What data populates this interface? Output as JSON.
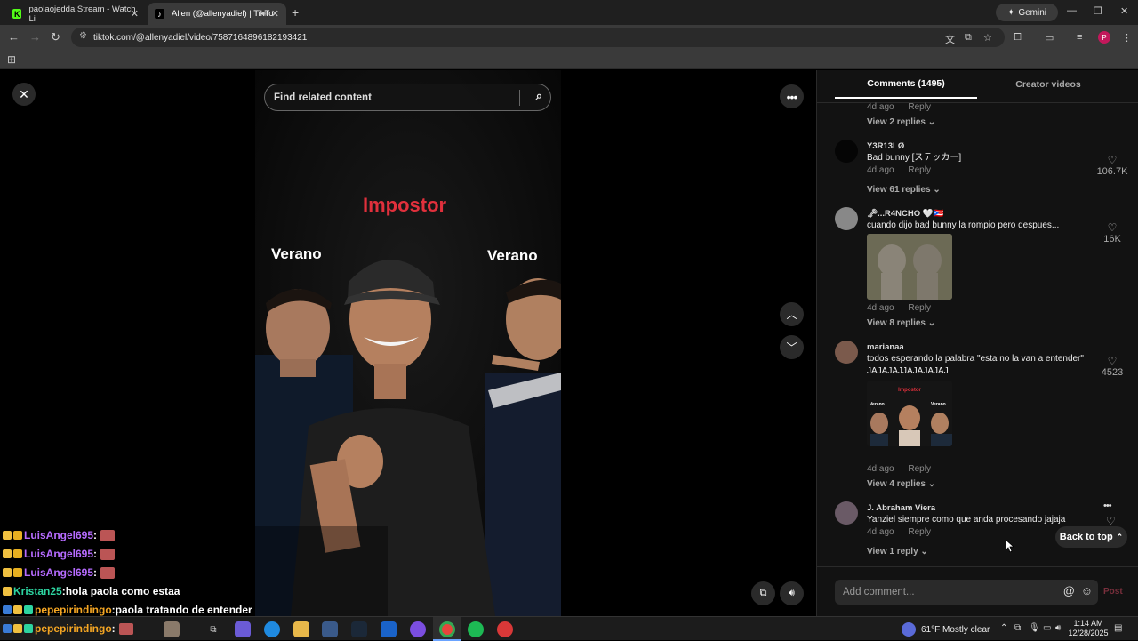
{
  "browser": {
    "tabs": [
      {
        "title": "paolaojedda Stream - Watch Li",
        "favicon": "kick-icon",
        "color": "#53fc18"
      },
      {
        "title": "Allen (@allenyadiel) | TikTo",
        "favicon": "tiktok-icon",
        "color": "#ffffff"
      }
    ],
    "new_tab_label": "+",
    "gemini_label": "Gemini",
    "url": "tiktok.com/@allenyadiel/video/7587164896182193421",
    "profile_initial": "P"
  },
  "video": {
    "search_placeholder": "Find related content",
    "overlay_title": "Impostor",
    "overlay_left": "Verano",
    "overlay_right": "Verano"
  },
  "comments_panel": {
    "tab_comments": "Comments (1495)",
    "tab_creator": "Creator videos",
    "top_meta": {
      "age": "4d ago",
      "reply": "Reply"
    },
    "top_view_replies": "View 2 replies",
    "comments": [
      {
        "user": "Y3R13LØ",
        "text": "Bad bunny [ステッカー]",
        "age": "4d ago",
        "reply": "Reply",
        "likes": "106.7K",
        "view_replies": "View 61 replies"
      },
      {
        "user": "🗝...R4NCHO 🤍🇵🇷",
        "text": "cuando dijo bad bunny la rompio pero despues...",
        "age": "4d ago",
        "reply": "Reply",
        "likes": "16K",
        "view_replies": "View 8 replies"
      },
      {
        "user": "marianaa",
        "text": "todos esperando la palabra \"esta no la van a entender\" JAJAJAJJAJAJAJAJ",
        "age": "4d ago",
        "reply": "Reply",
        "likes": "4523",
        "view_replies": "View 4 replies",
        "thumb_title": "Impostor",
        "thumb_left": "Verano",
        "thumb_right": "Verano"
      },
      {
        "user": "J. Abraham Viera",
        "text": "Yanziel siempre como que anda procesando jajaja",
        "age": "4d ago",
        "reply": "Reply",
        "view_replies": "View 1 reply"
      }
    ],
    "back_to_top": "Back to top",
    "comment_placeholder": "Add comment...",
    "post_label": "Post"
  },
  "chat": [
    {
      "user": "LuisAngel695",
      "sep": " :",
      "message": "",
      "color": "#b66bff"
    },
    {
      "user": "LuisAngel695",
      "sep": " :",
      "message": "",
      "color": "#b66bff"
    },
    {
      "user": "LuisAngel695",
      "sep": " :",
      "message": "",
      "color": "#b66bff"
    },
    {
      "user": "Kristan25",
      "sep": " :",
      "message": " hola paola como estaa",
      "color": "#2dd4a0"
    },
    {
      "user": "pepepirindingo",
      "sep": " :",
      "message": " paola tratando de entender",
      "color": "#f5a623"
    },
    {
      "user": "pepepirindingo",
      "sep": " :",
      "message": "",
      "color": "#f5a623"
    }
  ],
  "taskbar": {
    "weather": "61°F  Mostly clear",
    "time": "1:14 AM",
    "date": "12/28/2025"
  }
}
